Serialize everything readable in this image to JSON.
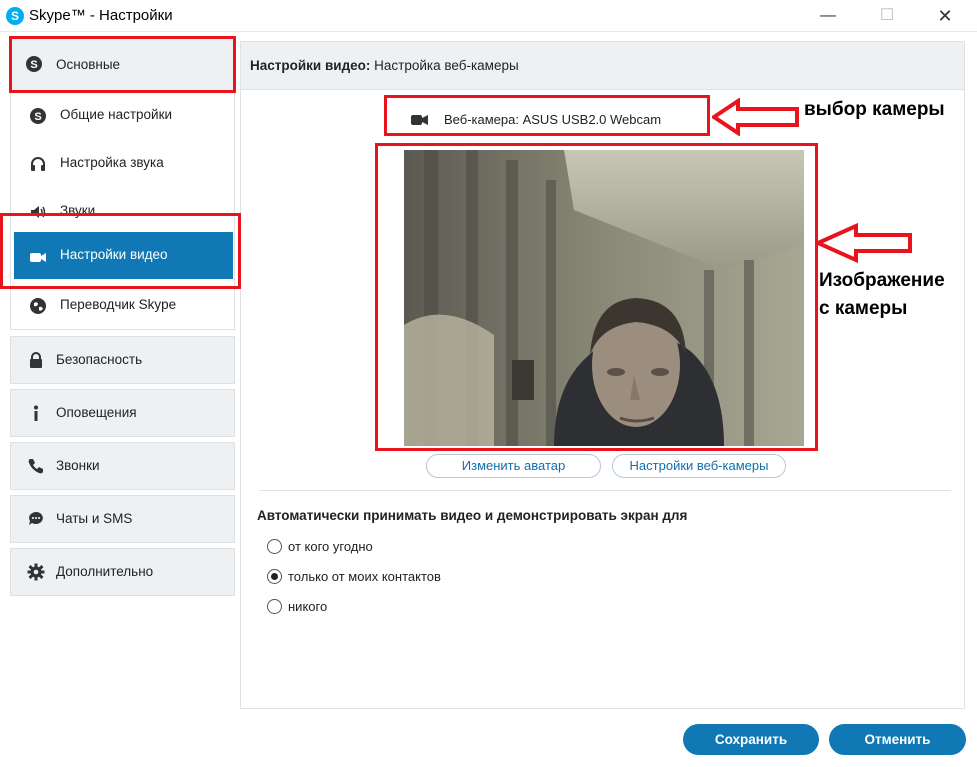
{
  "window": {
    "title": "Skype™ - Настройки",
    "app_icon_letter": "S"
  },
  "sidebar": {
    "main_group": {
      "header": {
        "label": "Основные",
        "icon": "skype-icon"
      },
      "items": [
        {
          "label": "Общие настройки",
          "icon": "skype-icon"
        },
        {
          "label": "Настройка звука",
          "icon": "headset-icon"
        },
        {
          "label": "Звуки",
          "icon": "speaker-icon"
        },
        {
          "label": "Настройки видео",
          "icon": "video-camera-icon",
          "active": true
        },
        {
          "label": "Переводчик Skype",
          "icon": "globe-icon"
        }
      ]
    },
    "groups": [
      {
        "label": "Безопасность",
        "icon": "lock-icon"
      },
      {
        "label": "Оповещения",
        "icon": "info-icon"
      },
      {
        "label": "Звонки",
        "icon": "phone-icon"
      },
      {
        "label": "Чаты и SMS",
        "icon": "chat-icon"
      },
      {
        "label": "Дополнительно",
        "icon": "gear-icon"
      }
    ]
  },
  "panel": {
    "header_bold": "Настройки видео:",
    "header_rest": " Настройка веб-камеры",
    "webcam_select": "Веб-камера:  ASUS USB2.0 Webcam",
    "change_avatar": "Изменить аватар",
    "webcam_settings": "Настройки веб-камеры",
    "auto_accept_title": "Автоматически принимать видео и демонстрировать экран для",
    "radio_options": [
      {
        "label": "от кого угодно",
        "checked": false
      },
      {
        "label": "только от моих контактов",
        "checked": true
      },
      {
        "label": "никого",
        "checked": false
      }
    ]
  },
  "footer": {
    "save": "Сохранить",
    "cancel": "Отменить"
  },
  "annotations": {
    "camera_choice": "выбор камеры",
    "camera_image_line1": "Изображение",
    "camera_image_line2": "с камеры"
  },
  "colors": {
    "accent": "#0f78b5",
    "annotation": "#e8141c",
    "sidebar_bg": "#eef1f4"
  }
}
